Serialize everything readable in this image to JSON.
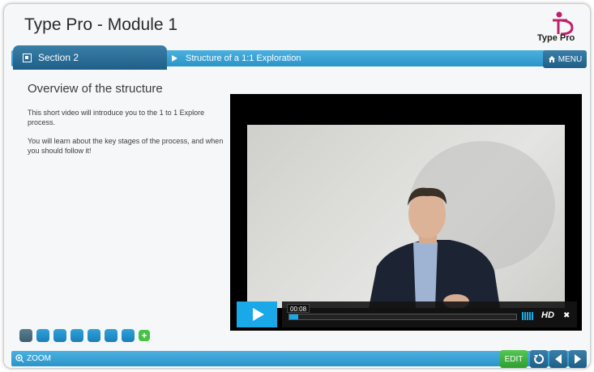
{
  "app": {
    "title": "Type Pro - Module 1",
    "logo_text": "Type Pro"
  },
  "nav": {
    "section_label": "Section 2",
    "breadcrumb": "Structure of a 1:1 Exploration",
    "menu_label": "MENU"
  },
  "content": {
    "heading": "Overview of the structure",
    "paragraphs": [
      "This short video will introduce you to the 1 to 1 Explore process.",
      "You will learn about the key stages of the process, and when you should follow it!"
    ]
  },
  "video": {
    "current_time": "00:08",
    "progress_fraction": 0.04,
    "hd_label": "HD",
    "icons": [
      "play-icon",
      "volume-icon",
      "fullscreen-icon"
    ]
  },
  "pager": {
    "page_count": 7,
    "current_index": 0,
    "add_label": "+"
  },
  "footer": {
    "zoom_label": "ZOOM",
    "edit_label": "EDIT",
    "icons": [
      "zoom-icon",
      "replay-icon",
      "previous-icon",
      "next-icon"
    ]
  },
  "colors": {
    "accent": "#2b94c8",
    "dark_accent": "#1f5f87",
    "play": "#19a8e8",
    "edit": "#3fb53f",
    "logo": "#c0206b"
  }
}
